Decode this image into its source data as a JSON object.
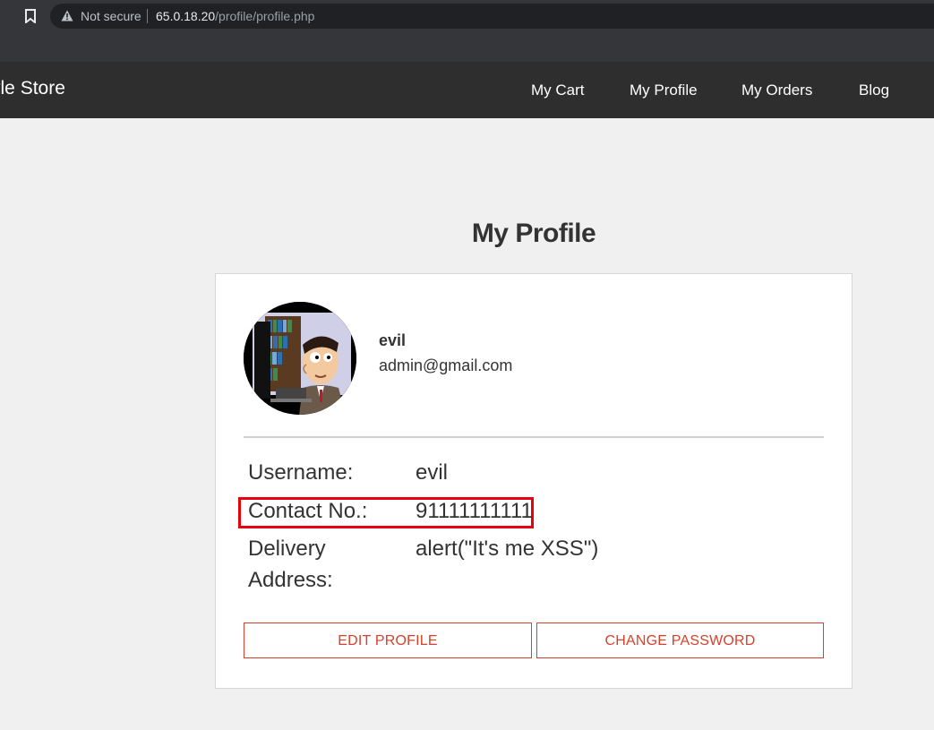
{
  "browser": {
    "security_label": "Not secure",
    "url_host": "65.0.18.20",
    "url_path": "/profile/profile.php"
  },
  "navbar": {
    "brand": "estyle Store",
    "items": [
      {
        "label": "My Cart"
      },
      {
        "label": "My Profile"
      },
      {
        "label": "My Orders"
      },
      {
        "label": "Blog"
      }
    ]
  },
  "page": {
    "title": "My Profile"
  },
  "profile": {
    "name": "evil",
    "email": "admin@gmail.com",
    "avatar_icon": "cartoon-avatar-image",
    "fields": [
      {
        "label": "Username:",
        "value": "evil"
      },
      {
        "label": "Contact No.:",
        "value": "91111111111"
      },
      {
        "label_line1": "Delivery",
        "label_line2": "Address:",
        "value": "alert(\"It's me XSS\")"
      }
    ],
    "buttons": {
      "edit": "EDIT PROFILE",
      "change_password": "CHANGE PASSWORD"
    }
  },
  "colors": {
    "accent": "#d8402a",
    "highlight_box": "#e8000c",
    "navbar_bg": "#2e2e2e"
  }
}
